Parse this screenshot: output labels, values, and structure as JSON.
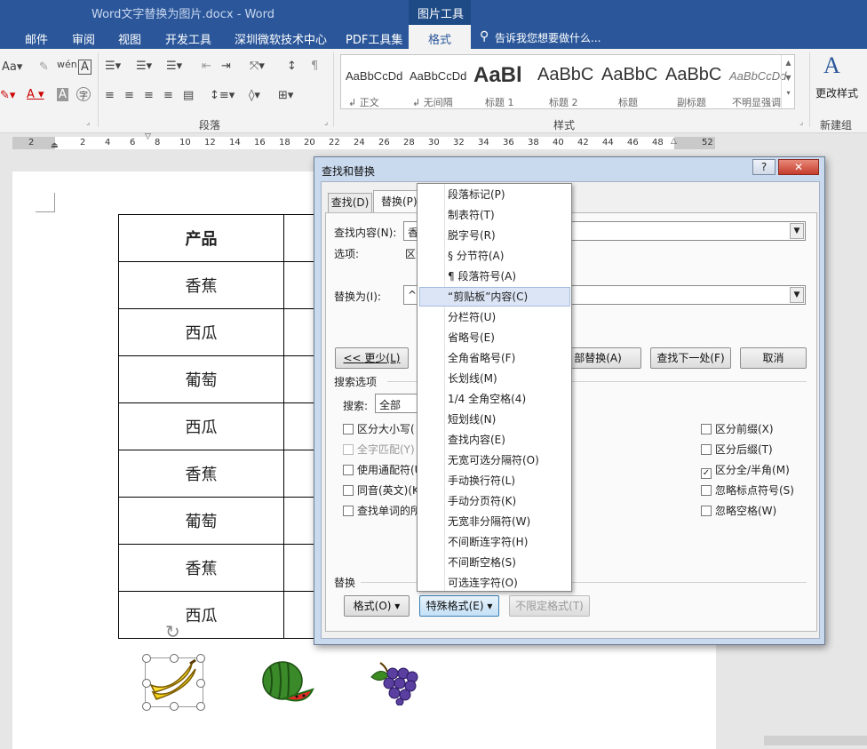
{
  "window": {
    "title": "Word文字替换为图片.docx - Word",
    "context_tab_group": "图片工具",
    "tell_me": "告诉我您想要做什么..."
  },
  "menu": {
    "items": [
      "邮件",
      "审阅",
      "视图",
      "开发工具",
      "深圳微软技术中心",
      "PDF工具集",
      "格式"
    ],
    "active": "格式"
  },
  "ribbon": {
    "group_paragraph": "段落",
    "group_styles": "样式",
    "group_new": "新建组",
    "change_styles": "更改样式",
    "styles": [
      {
        "sample": "AaBbCcDd",
        "name": "↲ 正文"
      },
      {
        "sample": "AaBbCcDd",
        "name": "↲ 无间隔"
      },
      {
        "sample": "AaBl",
        "name": "标题 1"
      },
      {
        "sample": "AaBbC",
        "name": "标题 2"
      },
      {
        "sample": "AaBbC",
        "name": "标题"
      },
      {
        "sample": "AaBbC",
        "name": "副标题"
      },
      {
        "sample": "AaBbCcDd",
        "name": "不明显强调"
      }
    ]
  },
  "ruler": {
    "ticks": [
      "2",
      "2",
      "4",
      "6",
      "8",
      "10",
      "12",
      "14",
      "16",
      "18",
      "20",
      "22",
      "24",
      "26",
      "28",
      "30",
      "32",
      "34",
      "36",
      "38",
      "40",
      "42",
      "44",
      "46",
      "48",
      "52"
    ]
  },
  "document": {
    "table_header": "产品",
    "table_rows": [
      "香蕉",
      "西瓜",
      "葡萄",
      "西瓜",
      "香蕉",
      "葡萄",
      "香蕉",
      "西瓜"
    ]
  },
  "dialog": {
    "title": "查找和替换",
    "help": "?",
    "tabs": [
      "查找(D)",
      "替换(P)"
    ],
    "find_label": "查找内容(N):",
    "find_value": "香",
    "options_label": "选项:",
    "options_value": "区分",
    "replace_label": "替换为(I):",
    "replace_value": "^c",
    "less_button": "<< 更少(L)",
    "replace_all_button": "部替换(A)",
    "find_next_button": "查找下一处(F)",
    "cancel_button": "取消",
    "search_options_label": "搜索选项",
    "search_label": "搜索:",
    "search_value": "全部",
    "left_checkboxes": [
      {
        "label": "区分大小写(",
        "checked": false,
        "disabled": false
      },
      {
        "label": "全字匹配(Y)",
        "checked": false,
        "disabled": true
      },
      {
        "label": "使用通配符(U",
        "checked": false,
        "disabled": false
      },
      {
        "label": "同音(英文)(K",
        "checked": false,
        "disabled": false
      },
      {
        "label": "查找单词的所",
        "checked": false,
        "disabled": false
      }
    ],
    "right_checkboxes": [
      {
        "label": "区分前缀(X)",
        "checked": false
      },
      {
        "label": "区分后缀(T)",
        "checked": false
      },
      {
        "label": "区分全/半角(M)",
        "checked": true
      },
      {
        "label": "忽略标点符号(S)",
        "checked": false
      },
      {
        "label": "忽略空格(W)",
        "checked": false
      }
    ],
    "replace_section_label": "替换",
    "format_button": "格式(O) ▾",
    "special_button": "特殊格式(E) ▾",
    "no_format_button": "不限定格式(T)"
  },
  "special_menu": {
    "items": [
      "段落标记(P)",
      "制表符(T)",
      "脱字号(R)",
      "§ 分节符(A)",
      "¶ 段落符号(A)",
      "“剪贴板”内容(C)",
      "分栏符(U)",
      "省略号(E)",
      "全角省略号(F)",
      "长划线(M)",
      "1/4 全角空格(4)",
      "短划线(N)",
      "查找内容(E)",
      "无宽可选分隔符(O)",
      "手动换行符(L)",
      "手动分页符(K)",
      "无宽非分隔符(W)",
      "不间断连字符(H)",
      "不间断空格(S)",
      "可选连字符(O)"
    ],
    "highlighted_index": 5
  },
  "colors": {
    "accent": "#2b579a",
    "highlight": "#dce5f5"
  }
}
